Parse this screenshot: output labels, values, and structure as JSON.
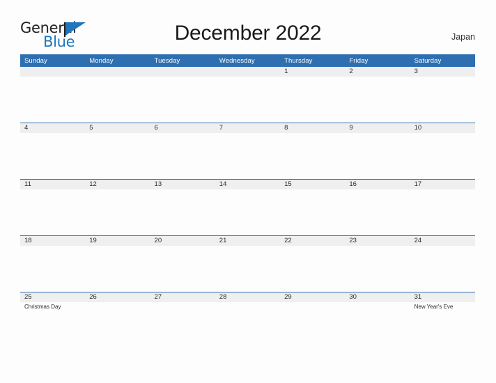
{
  "branding": {
    "logo_text_primary": "General",
    "logo_text_secondary": "Blue",
    "logo_icon": "flag-triangle-icon",
    "logo_color": "#1f76bc"
  },
  "header": {
    "title": "December 2022",
    "locale": "Japan"
  },
  "theme": {
    "header_background": "#2d6fb0",
    "row_rule": "#2d6fb0",
    "date_band": "#efefef",
    "page_background": "#fdfdfd"
  },
  "calendar": {
    "month": "December",
    "year": "2022",
    "weekday_headers": [
      "Sunday",
      "Monday",
      "Tuesday",
      "Wednesday",
      "Thursday",
      "Friday",
      "Saturday"
    ],
    "weeks": [
      [
        {
          "day": "",
          "event": ""
        },
        {
          "day": "",
          "event": ""
        },
        {
          "day": "",
          "event": ""
        },
        {
          "day": "",
          "event": ""
        },
        {
          "day": "1",
          "event": ""
        },
        {
          "day": "2",
          "event": ""
        },
        {
          "day": "3",
          "event": ""
        }
      ],
      [
        {
          "day": "4",
          "event": ""
        },
        {
          "day": "5",
          "event": ""
        },
        {
          "day": "6",
          "event": ""
        },
        {
          "day": "7",
          "event": ""
        },
        {
          "day": "8",
          "event": ""
        },
        {
          "day": "9",
          "event": ""
        },
        {
          "day": "10",
          "event": ""
        }
      ],
      [
        {
          "day": "11",
          "event": ""
        },
        {
          "day": "12",
          "event": ""
        },
        {
          "day": "13",
          "event": ""
        },
        {
          "day": "14",
          "event": ""
        },
        {
          "day": "15",
          "event": ""
        },
        {
          "day": "16",
          "event": ""
        },
        {
          "day": "17",
          "event": ""
        }
      ],
      [
        {
          "day": "18",
          "event": ""
        },
        {
          "day": "19",
          "event": ""
        },
        {
          "day": "20",
          "event": ""
        },
        {
          "day": "21",
          "event": ""
        },
        {
          "day": "22",
          "event": ""
        },
        {
          "day": "23",
          "event": ""
        },
        {
          "day": "24",
          "event": ""
        }
      ],
      [
        {
          "day": "25",
          "event": "Christmas Day"
        },
        {
          "day": "26",
          "event": ""
        },
        {
          "day": "27",
          "event": ""
        },
        {
          "day": "28",
          "event": ""
        },
        {
          "day": "29",
          "event": ""
        },
        {
          "day": "30",
          "event": ""
        },
        {
          "day": "31",
          "event": "New Year's Eve"
        }
      ]
    ]
  }
}
